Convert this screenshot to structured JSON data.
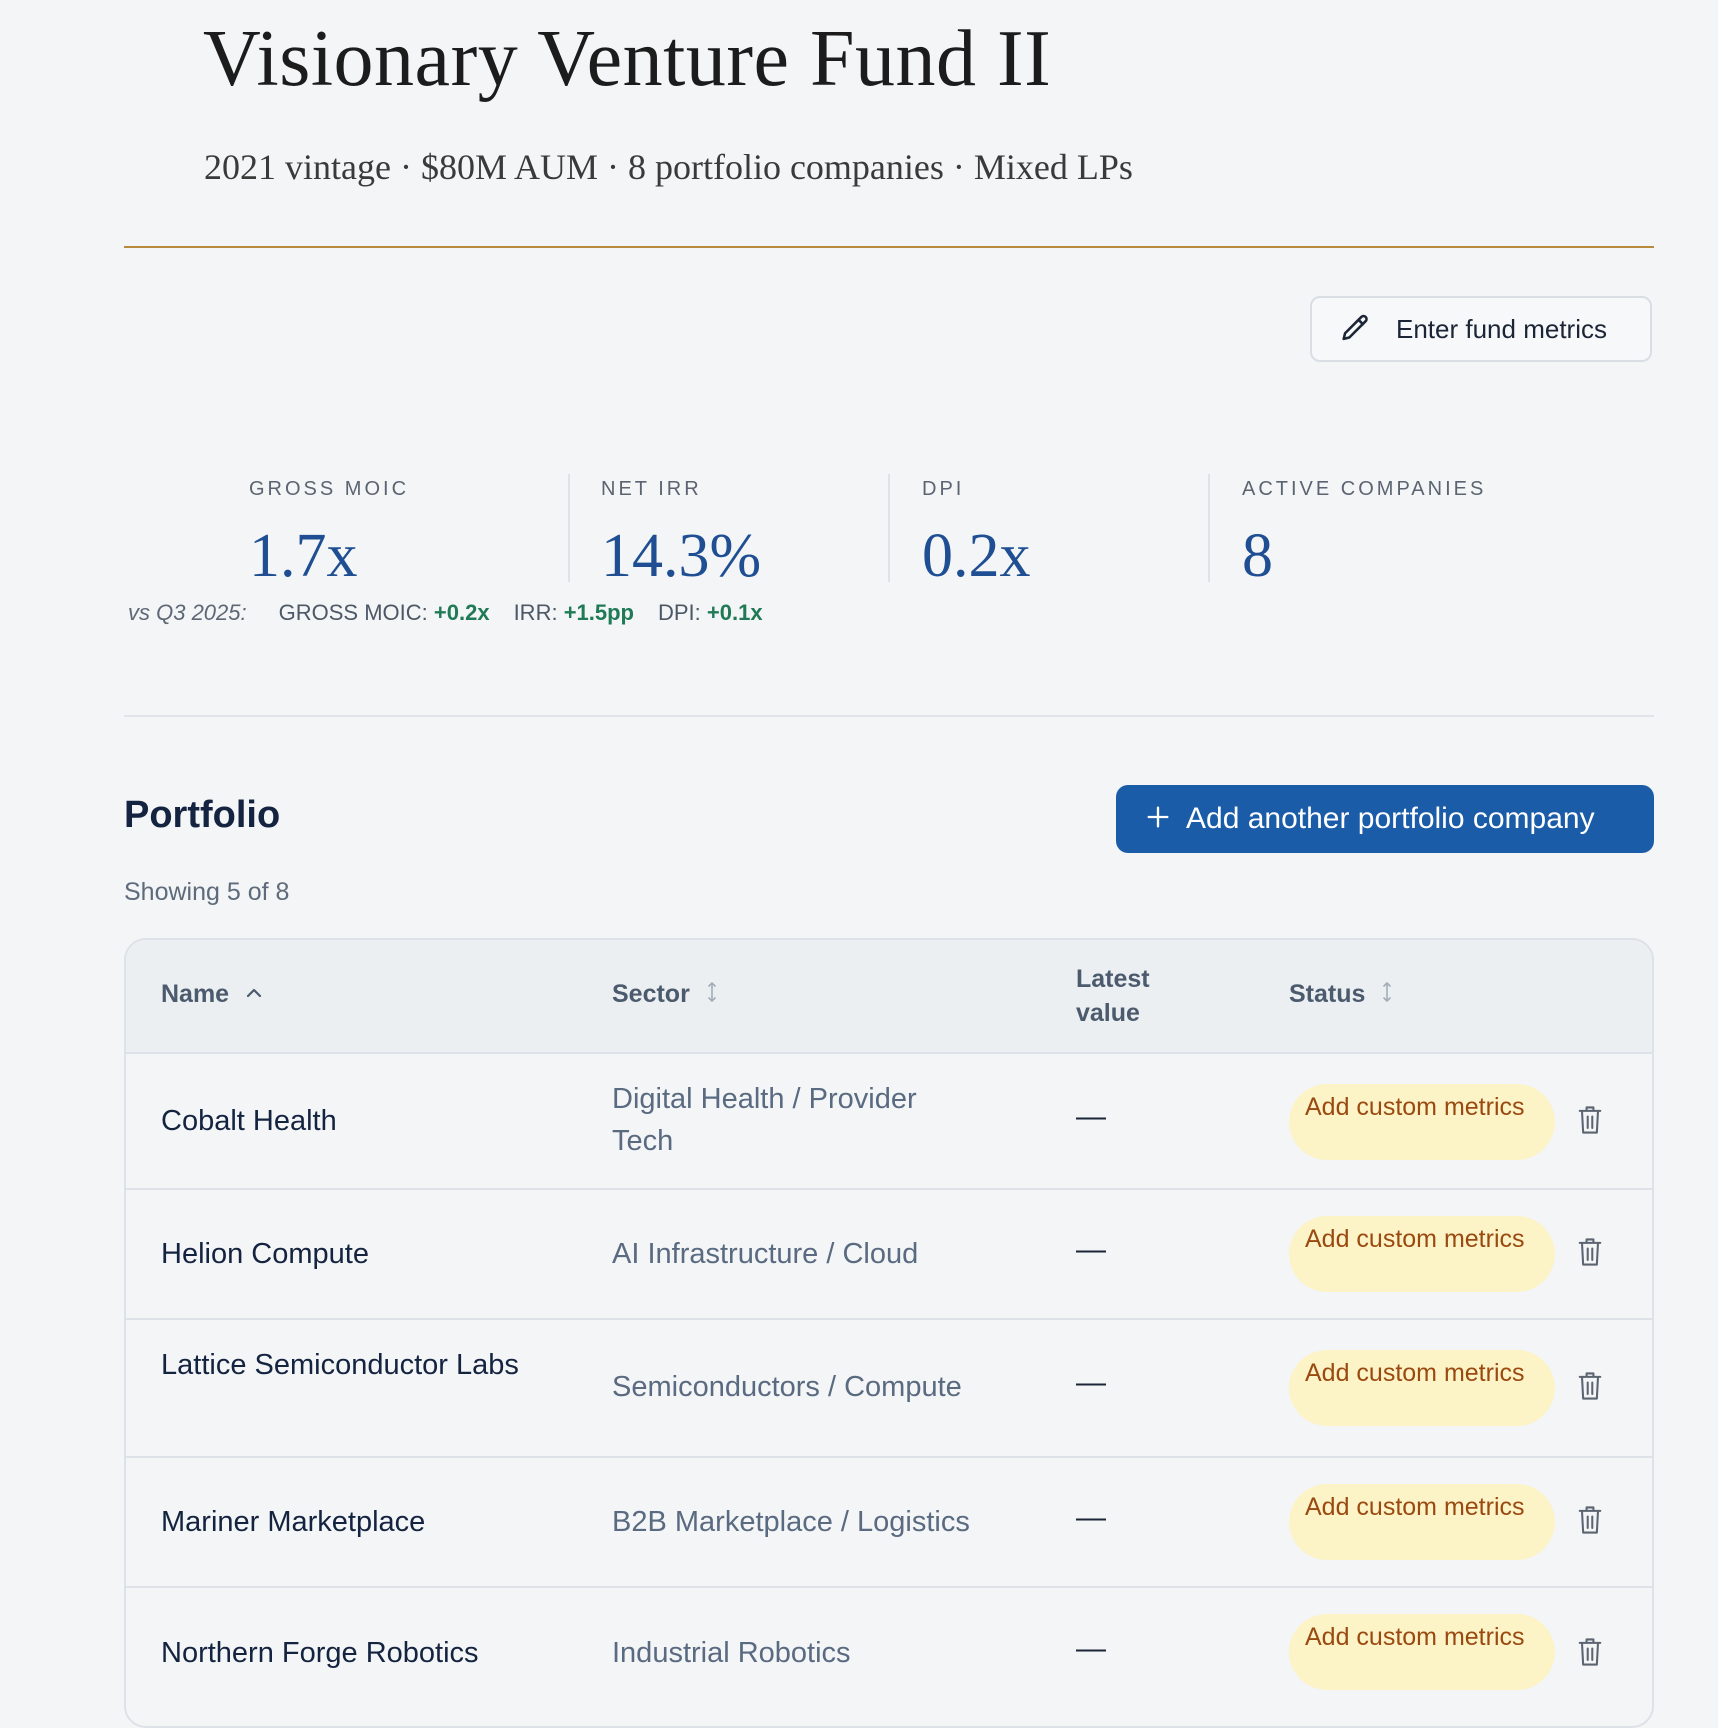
{
  "header": {
    "title": "Visionary Venture Fund II",
    "subtitle": "2021 vintage · $80M AUM · 8 portfolio companies · Mixed LPs",
    "enter_metrics_label": "Enter fund metrics"
  },
  "metrics": [
    {
      "label": "GROSS MOIC",
      "value": "1.7x"
    },
    {
      "label": "NET IRR",
      "value": "14.3%"
    },
    {
      "label": "DPI",
      "value": "0.2x"
    },
    {
      "label": "ACTIVE COMPANIES",
      "value": "8"
    }
  ],
  "deltas": {
    "vs_label": "vs Q3 2025:",
    "items": [
      {
        "label": "GROSS MOIC:",
        "value": "+0.2x"
      },
      {
        "label": "IRR:",
        "value": "+1.5pp"
      },
      {
        "label": "DPI:",
        "value": "+0.1x"
      }
    ]
  },
  "portfolio": {
    "title": "Portfolio",
    "add_label": "Add another portfolio company",
    "showing": "Showing 5 of 8",
    "columns": {
      "name": "Name",
      "sector": "Sector",
      "latest_value": "Latest value",
      "status": "Status"
    },
    "rows": [
      {
        "name": "Cobalt Health",
        "sector": "Digital Health / Provider Tech",
        "value": "—",
        "status": "Add custom metrics"
      },
      {
        "name": "Helion Compute",
        "sector": "AI Infrastructure / Cloud",
        "value": "—",
        "status": "Add custom metrics"
      },
      {
        "name": "Lattice Semiconductor Labs",
        "sector": "Semiconductors / Compute",
        "value": "—",
        "status": "Add custom metrics"
      },
      {
        "name": "Mariner Marketplace",
        "sector": "B2B Marketplace / Logistics",
        "value": "—",
        "status": "Add custom metrics"
      },
      {
        "name": "Northern Forge Robotics",
        "sector": "Industrial Robotics",
        "value": "—",
        "status": "Add custom metrics"
      }
    ]
  },
  "colors": {
    "accent": "#1b5ca8",
    "metric_value": "#1f4f92",
    "positive": "#1f7a55",
    "badge_bg": "#fcf3c6",
    "badge_text": "#9a4a10",
    "gold_rule": "#b98a3e"
  },
  "icons": {
    "enter_metrics": "pencil-icon",
    "add": "plus-icon",
    "sort_active": "chevron-up-icon",
    "sort": "sort-icon",
    "delete": "trash-icon"
  }
}
